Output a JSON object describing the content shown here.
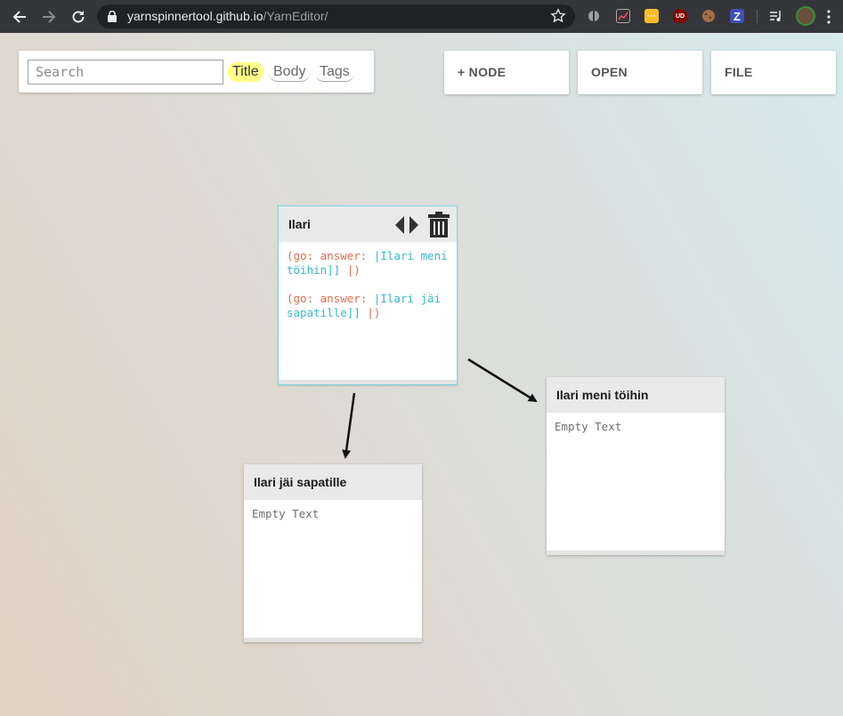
{
  "browser": {
    "url_host": "yarnspinnertool.github.io",
    "url_path": "/YarnEditor/"
  },
  "toolbar": {
    "search_placeholder": "Search",
    "filters": [
      {
        "label": "Title",
        "active": true
      },
      {
        "label": "Body",
        "active": false
      },
      {
        "label": "Tags",
        "active": false
      }
    ],
    "add_node_label": "+ NODE",
    "open_label": "OPEN",
    "file_label": "FILE"
  },
  "nodes": [
    {
      "title": "Ilari",
      "selected": true,
      "body": [
        {
          "prefix": "(go: answer: ",
          "link": "|Ilari meni töihin]]",
          "suffix": " |)"
        },
        {
          "prefix": "(go: answer: ",
          "link": "|Ilari jäi sapatille]]",
          "suffix": " |)"
        }
      ]
    },
    {
      "title": "Ilari jäi sapatille",
      "body_text": "Empty Text"
    },
    {
      "title": "Ilari meni töihin",
      "body_text": "Empty Text"
    }
  ],
  "colors": {
    "link": "#31b9cc",
    "command": "#e06c4a",
    "title_highlight": "#ffff88",
    "selected_outline": "#7fd6e0"
  }
}
